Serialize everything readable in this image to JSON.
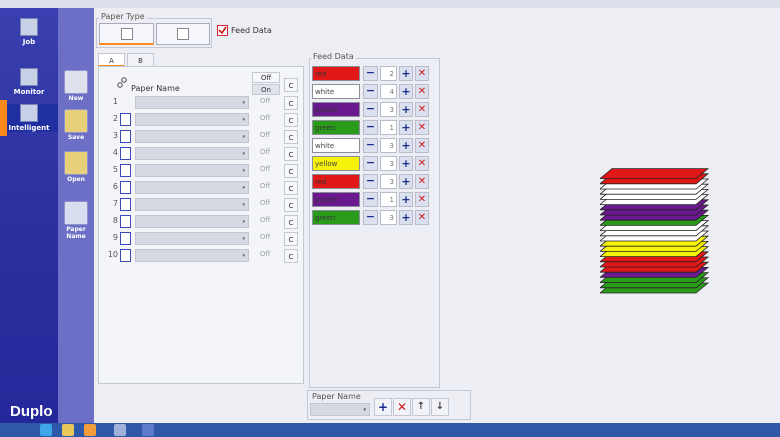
{
  "nav": {
    "items": [
      {
        "label": "Job",
        "icon": "job-icon"
      },
      {
        "label": "Monitor",
        "icon": "monitor-icon"
      },
      {
        "label": "Intelligent",
        "icon": "intelligent-icon"
      }
    ],
    "brand": "Duplo",
    "active_accent": "#ff8a1a"
  },
  "tools": {
    "items": [
      {
        "label": "New",
        "icon": "new-file-icon"
      },
      {
        "label": "Save",
        "icon": "save-folder-icon"
      },
      {
        "label": "Open",
        "icon": "open-folder-icon"
      },
      {
        "label": "Paper Name",
        "icon": "paper-name-icon"
      }
    ]
  },
  "paper_type": {
    "title": "Paper Type",
    "feed_data_label": "Feed Data"
  },
  "tabs": [
    "A",
    "B"
  ],
  "paper_list": {
    "header": "Paper Name",
    "off_label": "Off",
    "on_label": "On",
    "c_label": "C",
    "rows": [
      {
        "num": "1",
        "status": "Off"
      },
      {
        "num": "2",
        "status": "Off"
      },
      {
        "num": "3",
        "status": "Off"
      },
      {
        "num": "4",
        "status": "Off"
      },
      {
        "num": "5",
        "status": "Off"
      },
      {
        "num": "6",
        "status": "Off"
      },
      {
        "num": "7",
        "status": "Off"
      },
      {
        "num": "8",
        "status": "Off"
      },
      {
        "num": "9",
        "status": "Off"
      },
      {
        "num": "10",
        "status": "Off"
      }
    ]
  },
  "feed_data": {
    "title": "Feed Data",
    "rows": [
      {
        "name": "red",
        "count": "2",
        "color": "#e01818"
      },
      {
        "name": "white",
        "count": "4",
        "color": "#ffffff"
      },
      {
        "name": "purple",
        "count": "3",
        "color": "#6a1a8e"
      },
      {
        "name": "green",
        "count": "1",
        "color": "#2a9a1a"
      },
      {
        "name": "white",
        "count": "3",
        "color": "#ffffff"
      },
      {
        "name": "yellow",
        "count": "3",
        "color": "#f6f20a"
      },
      {
        "name": "red",
        "count": "3",
        "color": "#e01818"
      },
      {
        "name": "purple",
        "count": "1",
        "color": "#6a1a8e"
      },
      {
        "name": "green",
        "count": "3",
        "color": "#2a9a1a"
      }
    ]
  },
  "paper_name_bottom": {
    "label": "Paper Name"
  },
  "stack": {
    "layers_bottom_to_top": [
      "#2a9a1a",
      "#2a9a1a",
      "#2a9a1a",
      "#6a1a8e",
      "#e01818",
      "#e01818",
      "#e01818",
      "#f6f20a",
      "#f6f20a",
      "#f6f20a",
      "#ffffff",
      "#ffffff",
      "#ffffff",
      "#2a9a1a",
      "#6a1a8e",
      "#6a1a8e",
      "#6a1a8e",
      "#ffffff",
      "#ffffff",
      "#ffffff",
      "#ffffff",
      "#e01818",
      "#e01818"
    ]
  }
}
